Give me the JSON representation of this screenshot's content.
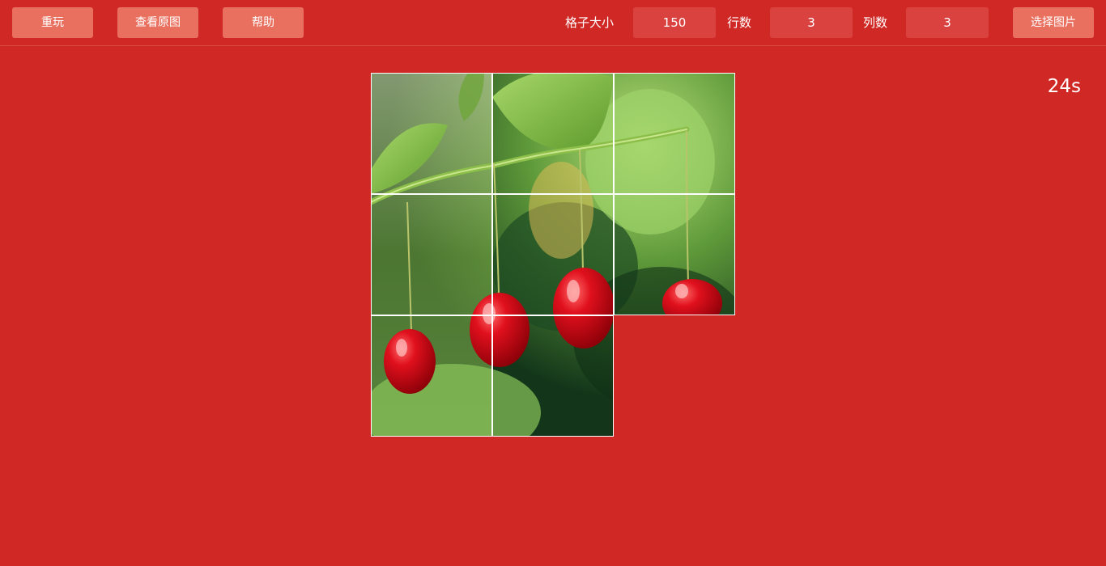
{
  "toolbar": {
    "replay_label": "重玩",
    "view_original_label": "查看原图",
    "help_label": "帮助",
    "cell_size_label": "格子大小",
    "cell_size_value": "150",
    "rows_label": "行数",
    "rows_value": "3",
    "cols_label": "列数",
    "cols_value": "3",
    "choose_image_label": "选择图片"
  },
  "timer": {
    "text": "24s"
  },
  "puzzle": {
    "rows": 3,
    "cols": 3,
    "image_subject": "red cherries hanging from a green branch",
    "tiles": [
      {
        "row": 0,
        "col": 0,
        "piece": 0
      },
      {
        "row": 0,
        "col": 1,
        "piece": 1
      },
      {
        "row": 0,
        "col": 2,
        "piece": 2
      },
      {
        "row": 1,
        "col": 0,
        "piece": 3
      },
      {
        "row": 1,
        "col": 1,
        "piece": 4
      },
      {
        "row": 1,
        "col": 2,
        "piece": 5
      },
      {
        "row": 2,
        "col": 0,
        "piece": 6
      },
      {
        "row": 2,
        "col": 1,
        "piece": 7
      }
    ],
    "empty": {
      "row": 2,
      "col": 2
    }
  },
  "colors": {
    "background": "#d02825",
    "button": "#e9705f",
    "field": "#d9423f",
    "text": "#ffffff"
  }
}
